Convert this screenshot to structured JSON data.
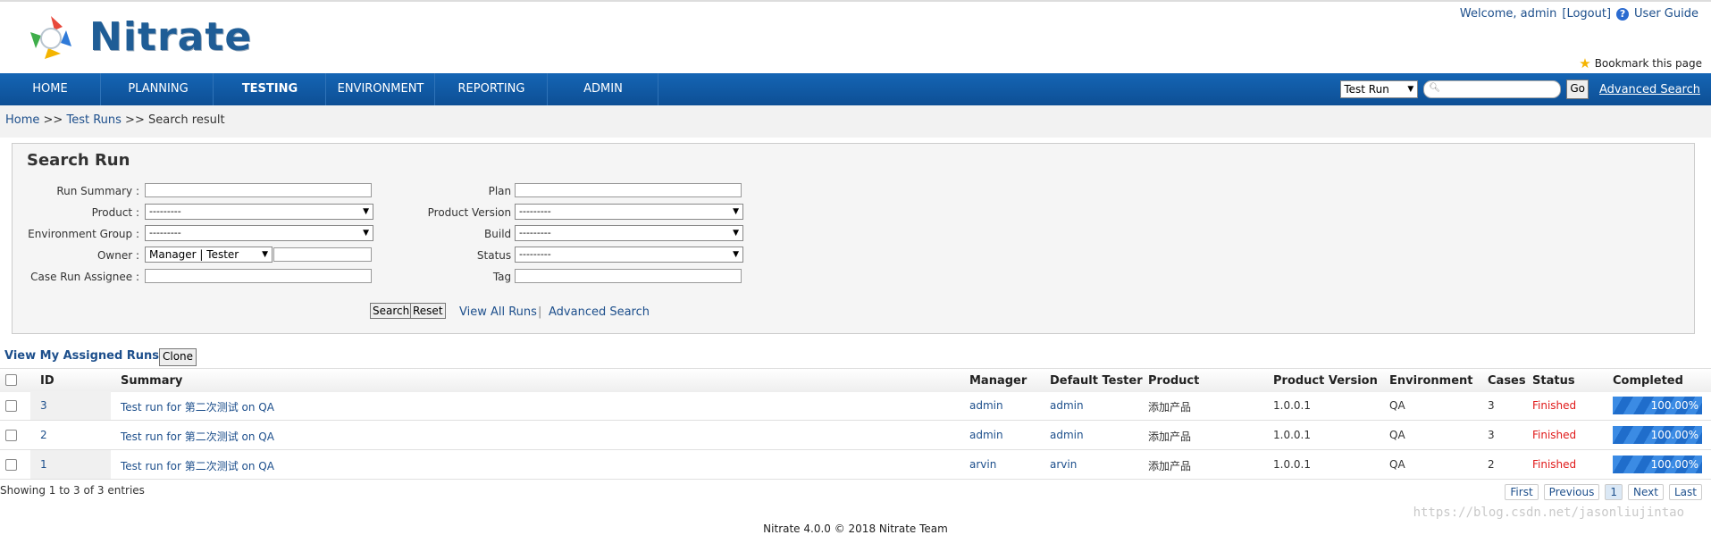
{
  "header": {
    "logo_text": "Nitrate",
    "welcome": "Welcome, admin",
    "logout": "[Logout]",
    "user_guide": "User Guide",
    "bookmark": "Bookmark this page"
  },
  "nav": {
    "items": [
      "HOME",
      "PLANNING",
      "TESTING",
      "ENVIRONMENT",
      "REPORTING",
      "ADMIN"
    ],
    "active": "TESTING",
    "search_type": "Test Run",
    "go": "Go",
    "advanced_search": "Advanced Search"
  },
  "breadcrumb": {
    "home": "Home",
    "sep1": ">>",
    "runs": "Test Runs",
    "sep2": ">>",
    "current": "Search result"
  },
  "search": {
    "title": "Search Run",
    "labels": {
      "summary": "Run Summary :",
      "product": "Product :",
      "env_group": "Environment Group :",
      "owner": "Owner :",
      "assignee": "Case Run Assignee :",
      "plan": "Plan :",
      "product_version": "Product Version :",
      "build": "Build :",
      "status": "Status :",
      "tag": "Tag :"
    },
    "select_default": "---------",
    "owner_role": "Manager | Tester",
    "search_btn": "Search",
    "reset_btn": "Reset",
    "view_all": "View All Runs",
    "pipe": "|",
    "advanced": "Advanced Search"
  },
  "runs": {
    "title": "View My Assigned Runs",
    "clone": "Clone",
    "columns": [
      "ID",
      "Summary",
      "Manager",
      "Default Tester",
      "Product",
      "Product Version",
      "Environment",
      "Cases",
      "Status",
      "Completed"
    ],
    "rows": [
      {
        "id": "3",
        "summary": "Test run for 第二次测试 on QA",
        "manager": "admin",
        "tester": "admin",
        "product": "添加产品",
        "version": "1.0.0.1",
        "env": "QA",
        "cases": "3",
        "status": "Finished",
        "completed": "100.00%",
        "completed_value": 100
      },
      {
        "id": "2",
        "summary": "Test run for 第二次测试 on QA",
        "manager": "admin",
        "tester": "admin",
        "product": "添加产品",
        "version": "1.0.0.1",
        "env": "QA",
        "cases": "3",
        "status": "Finished",
        "completed": "100.00%",
        "completed_value": 100
      },
      {
        "id": "1",
        "summary": "Test run for 第二次测试 on QA",
        "manager": "arvin",
        "tester": "arvin",
        "product": "添加产品",
        "version": "1.0.0.1",
        "env": "QA",
        "cases": "2",
        "status": "Finished",
        "completed": "100.00%",
        "completed_value": 100
      }
    ],
    "showing": "Showing 1 to 3 of 3 entries",
    "pager": [
      "First",
      "Previous",
      "1",
      "Next",
      "Last"
    ]
  },
  "footer": "Nitrate 4.0.0 © 2018 Nitrate Team",
  "watermark": "https://blog.csdn.net/jasonliujintao",
  "colors": {
    "nav": "#1565b4",
    "link": "#1d4f8c",
    "status": "#e01a1a",
    "progress": "#2f7ad8"
  }
}
